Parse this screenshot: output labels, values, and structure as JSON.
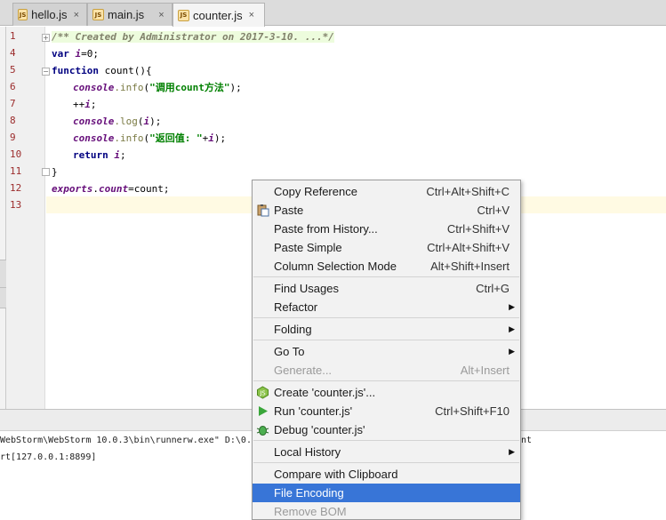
{
  "tabs": [
    {
      "label": "hello.js",
      "icon": "js-file-icon"
    },
    {
      "label": "main.js",
      "icon": "js-file-icon"
    },
    {
      "label": "counter.js",
      "icon": "js-file-icon",
      "active": true
    }
  ],
  "tab_close_glyph": "×",
  "js_badge": "JS",
  "gutter": {
    "line_numbers": [
      "1",
      "4",
      "5",
      "6",
      "7",
      "8",
      "9",
      "10",
      "11",
      "12",
      "13"
    ]
  },
  "code": {
    "line1": "/** Created by Administrator on 2017-3-10. ...*/",
    "line4_kw": "var ",
    "line4_var": "i",
    "line4_rest": "=0;",
    "line5_kw": "function ",
    "line5_rest": "count(){",
    "line6_con": "console",
    "line6_fn": ".info",
    "line6_p1": "(",
    "line6_str": "\"调用count方法\"",
    "line6_p2": ");",
    "line7_op": "++",
    "line7_var": "i",
    "line7_end": ";",
    "line8_con": "console",
    "line8_fn": ".log",
    "line8_p1": "(",
    "line8_var": "i",
    "line8_p2": ");",
    "line9_con": "console",
    "line9_fn": ".info",
    "line9_p1": "(",
    "line9_str": "\"返回值: \"",
    "line9_plus": "+",
    "line9_var": "i",
    "line9_p2": ");",
    "line10_kw": "return ",
    "line10_var": "i",
    "line10_end": ";",
    "line11": "}",
    "line12_con": "exports",
    "line12_dot": ".",
    "line12_prop": "count",
    "line12_rest": "=count;"
  },
  "console": {
    "line1": "WebStorm\\WebStorm 10.0.3\\bin\\runnerw.exe\" D:\\0.S",
    "line1_tail": "nt",
    "line2": "rt[127.0.0.1:8899]"
  },
  "menu": {
    "items": [
      {
        "label": "Copy Reference",
        "shortcut": "Ctrl+Alt+Shift+C"
      },
      {
        "label": "Paste",
        "shortcut": "Ctrl+V",
        "icon": "paste-icon"
      },
      {
        "label": "Paste from History...",
        "shortcut": "Ctrl+Shift+V"
      },
      {
        "label": "Paste Simple",
        "shortcut": "Ctrl+Alt+Shift+V"
      },
      {
        "label": "Column Selection Mode",
        "shortcut": "Alt+Shift+Insert"
      },
      {
        "label": "Find Usages",
        "shortcut": "Ctrl+G"
      },
      {
        "label": "Refactor",
        "submenu": true
      },
      {
        "label": "Folding",
        "submenu": true
      },
      {
        "label": "Go To",
        "submenu": true
      },
      {
        "label": "Generate...",
        "shortcut": "Alt+Insert",
        "disabled": true
      },
      {
        "label": "Create 'counter.js'...",
        "icon": "nodejs-icon"
      },
      {
        "label": "Run 'counter.js'",
        "shortcut": "Ctrl+Shift+F10",
        "icon": "run-icon"
      },
      {
        "label": "Debug 'counter.js'",
        "icon": "debug-icon"
      },
      {
        "label": "Local History",
        "submenu": true
      },
      {
        "label": "Compare with Clipboard"
      },
      {
        "label": "File Encoding",
        "selected": true
      },
      {
        "label": "Remove BOM",
        "disabled": true
      }
    ],
    "submenu_glyph": "▶"
  },
  "colors": {
    "accent_selection": "#3875d7",
    "line_number": "#9b2b2b",
    "keyword": "#000080",
    "string": "#008000",
    "current_line": "#fffae3"
  }
}
